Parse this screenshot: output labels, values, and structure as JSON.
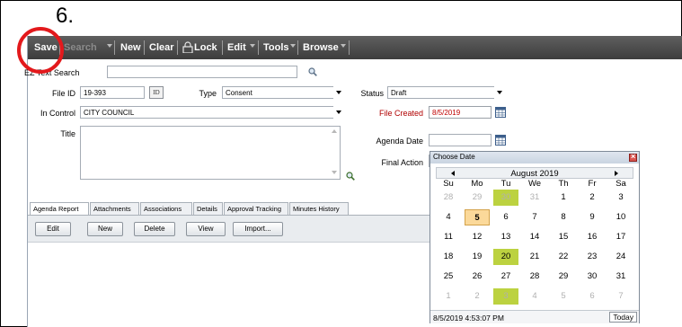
{
  "step_label": "6.",
  "toolbar": {
    "save": "Save",
    "search": "Search",
    "new": "New",
    "clear": "Clear",
    "lock": "Lock",
    "edit": "Edit",
    "tools": "Tools",
    "browse": "Browse"
  },
  "form": {
    "ez_text_search_label": "EZ Text Search",
    "ez_text_search_value": "",
    "file_id_label": "File ID",
    "file_id_value": "19-393",
    "id_button": "ID",
    "type_label": "Type",
    "type_value": "Consent",
    "status_label": "Status",
    "status_value": "Draft",
    "in_control_label": "In Control",
    "in_control_value": "CITY COUNCIL",
    "file_created_label": "File Created",
    "file_created_value": "8/5/2019",
    "title_label": "Title",
    "title_value": "",
    "agenda_date_label": "Agenda Date",
    "agenda_date_value": "",
    "final_action_label": "Final Action",
    "final_action_value": ""
  },
  "tabs": [
    {
      "label": "Agenda Report"
    },
    {
      "label": "Attachments"
    },
    {
      "label": "Associations"
    },
    {
      "label": "Details"
    },
    {
      "label": "Approval Tracking"
    },
    {
      "label": "Minutes History"
    }
  ],
  "actions": {
    "edit": "Edit",
    "new": "New",
    "delete": "Delete",
    "view": "View",
    "import": "Import..."
  },
  "calendar": {
    "title": "Choose Date",
    "month": "August 2019",
    "weekdays": [
      "Su",
      "Mo",
      "Tu",
      "We",
      "Th",
      "Fr",
      "Sa"
    ],
    "weeks": [
      [
        "28",
        "29",
        "30",
        "31",
        "1",
        "2",
        "3"
      ],
      [
        "4",
        "5",
        "6",
        "7",
        "8",
        "9",
        "10"
      ],
      [
        "11",
        "12",
        "13",
        "14",
        "15",
        "16",
        "17"
      ],
      [
        "18",
        "19",
        "20",
        "21",
        "22",
        "23",
        "24"
      ],
      [
        "25",
        "26",
        "27",
        "28",
        "29",
        "30",
        "31"
      ],
      [
        "1",
        "2",
        "3",
        "4",
        "5",
        "6",
        "7"
      ]
    ],
    "selected_day": "5",
    "highlighted_days": [
      "30",
      "20",
      "3"
    ],
    "datetime": "8/5/2019 4:53:07 PM",
    "today_button": "Today"
  },
  "colors": {
    "annotation_circle": "#e3191c",
    "highlight": "#bcd240",
    "selected": "#fbd99a",
    "required_label": "#b00000"
  }
}
